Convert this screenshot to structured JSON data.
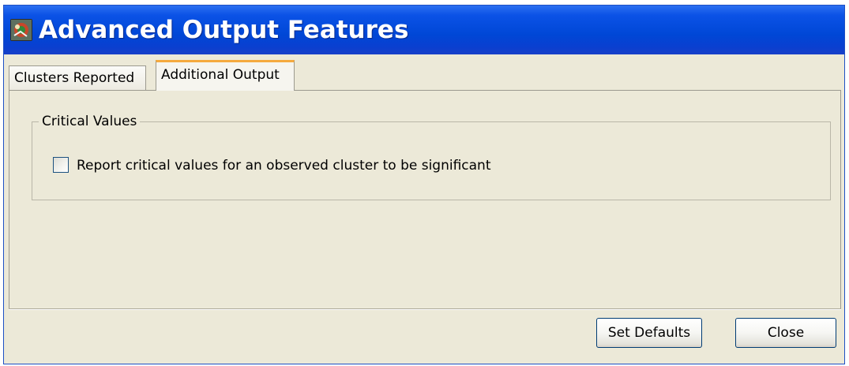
{
  "window": {
    "title": "Advanced Output Features",
    "icon": "satscan-app-icon"
  },
  "tabs": [
    {
      "label": "Clusters Reported",
      "selected": false
    },
    {
      "label": "Additional Output",
      "selected": true
    }
  ],
  "panel": {
    "group_title": "Critical Values",
    "checkbox": {
      "label": "Report critical values for an observed cluster to be significant",
      "checked": false
    }
  },
  "buttons": {
    "set_defaults": "Set Defaults",
    "close": "Close"
  },
  "colors": {
    "titlebar": "#0047d6",
    "window_bg": "#ece9d8",
    "active_tab_accent": "#f5aa3e"
  }
}
